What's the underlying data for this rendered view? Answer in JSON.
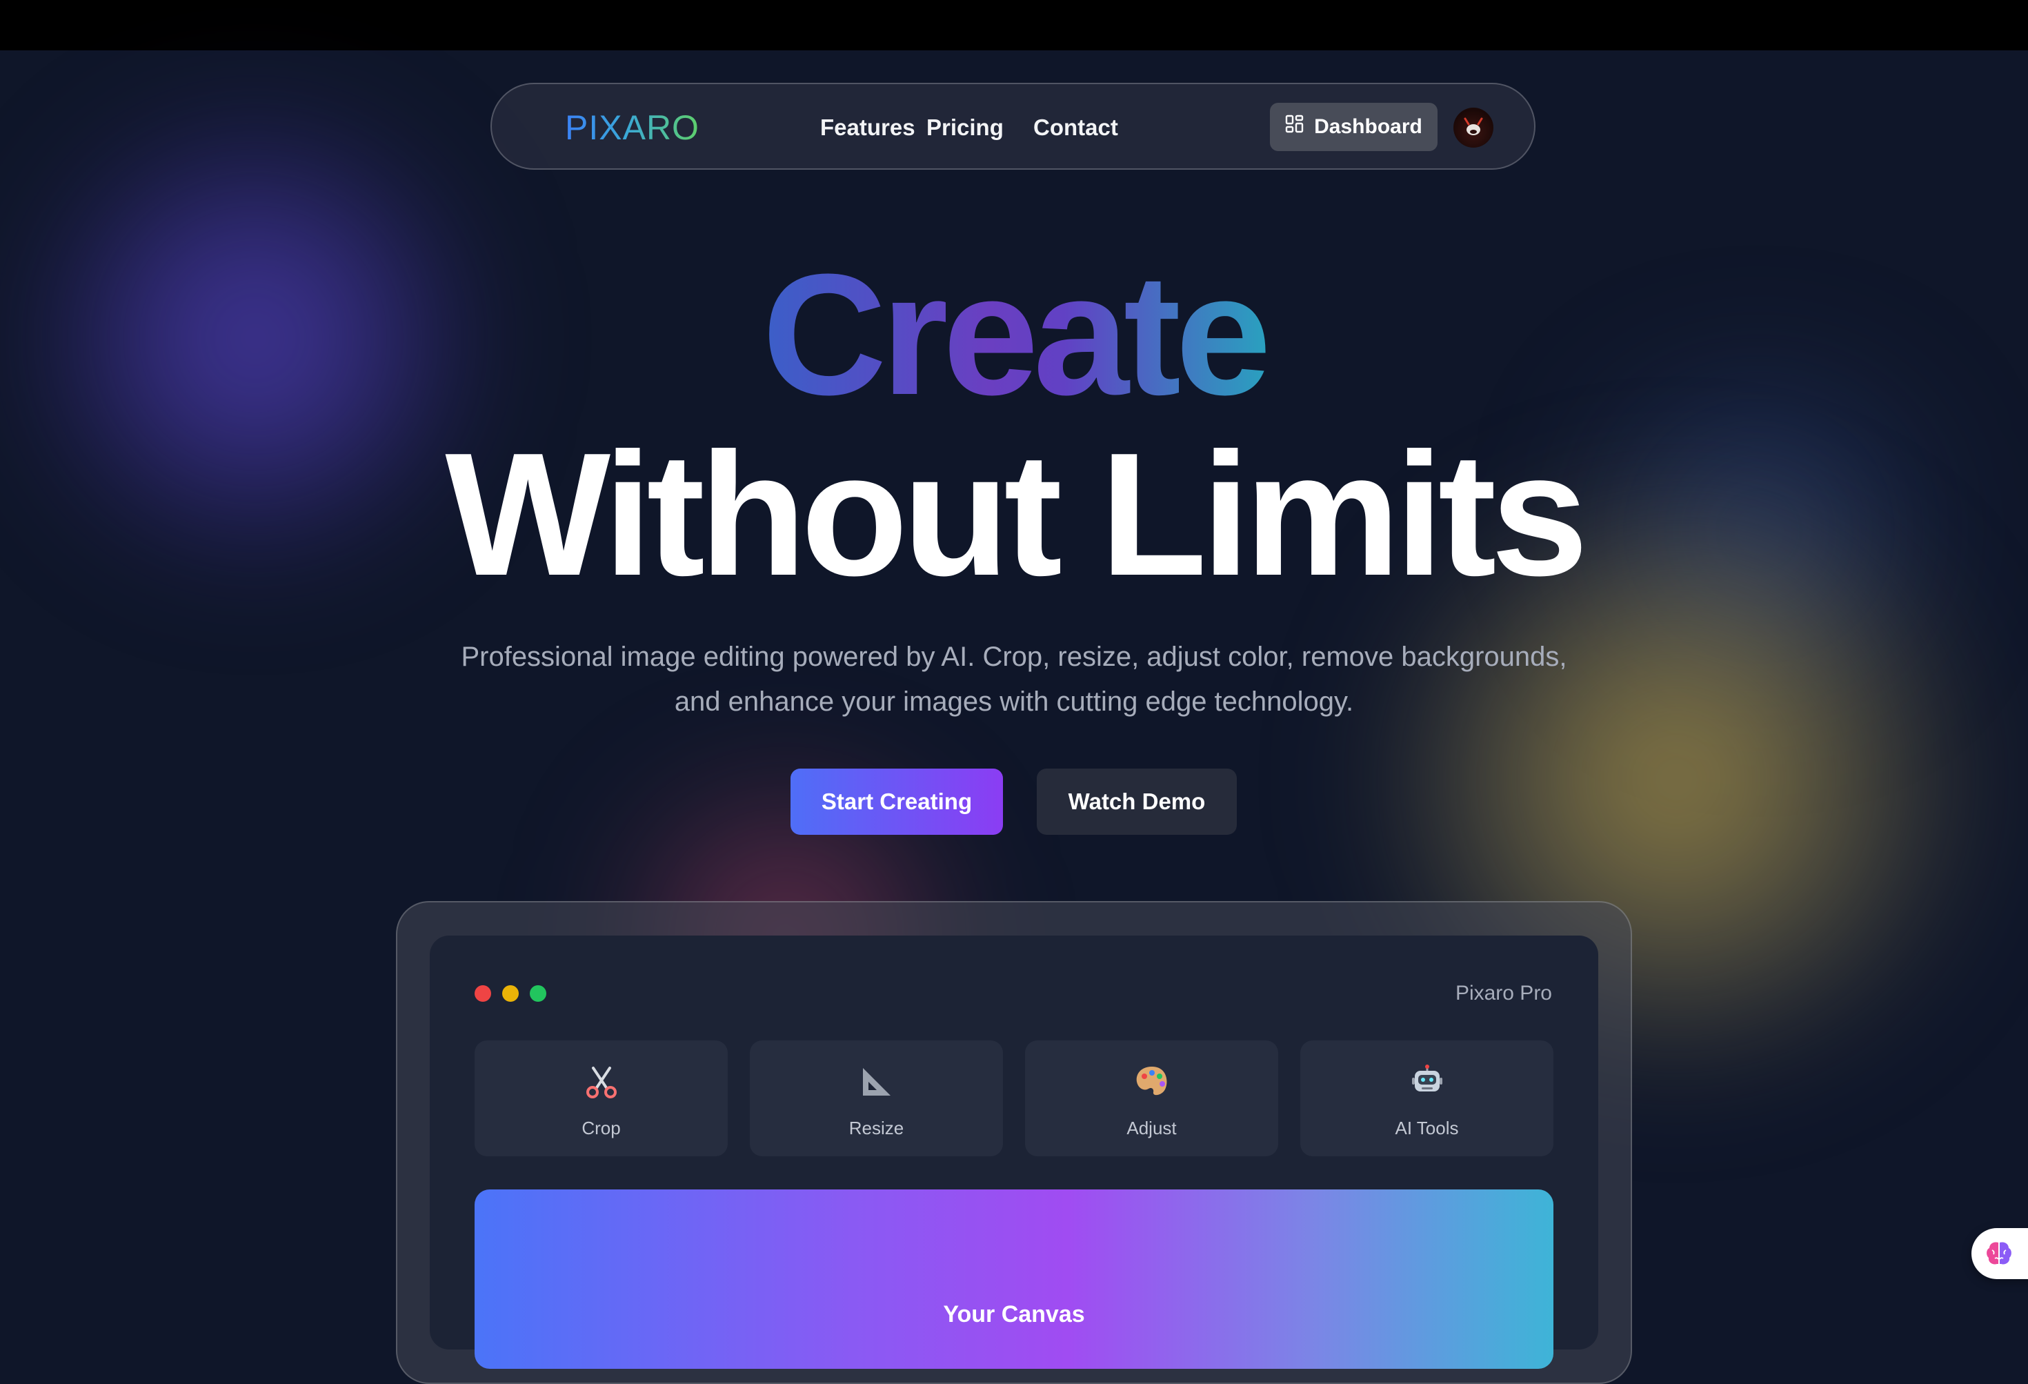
{
  "nav": {
    "logo": "PIXARO",
    "links": [
      "Features",
      "Pricing",
      "Contact"
    ],
    "dashboard_label": "Dashboard",
    "dashboard_icon": "grid-icon",
    "avatar_icon": "avatar"
  },
  "hero": {
    "line1": "Create",
    "line2": "Without Limits",
    "subtitle": "Professional image editing powered by AI. Crop, resize, adjust color, remove backgrounds, and enhance your images with cutting edge technology.",
    "primary_cta": "Start Creating",
    "secondary_cta": "Watch Demo"
  },
  "preview": {
    "window_title": "Pixaro Pro",
    "window_dots": [
      "#ef4444",
      "#eab308",
      "#22c55e"
    ],
    "tools": [
      {
        "label": "Crop",
        "icon": "scissors-icon"
      },
      {
        "label": "Resize",
        "icon": "triangle-ruler-icon"
      },
      {
        "label": "Adjust",
        "icon": "palette-icon"
      },
      {
        "label": "AI Tools",
        "icon": "robot-icon"
      }
    ],
    "canvas_label": "Your Canvas"
  },
  "floating_button_icon": "brain-icon",
  "colors": {
    "background": "#0f1629",
    "accent_start": "#4f6ef7",
    "accent_end": "#8b3df3"
  }
}
